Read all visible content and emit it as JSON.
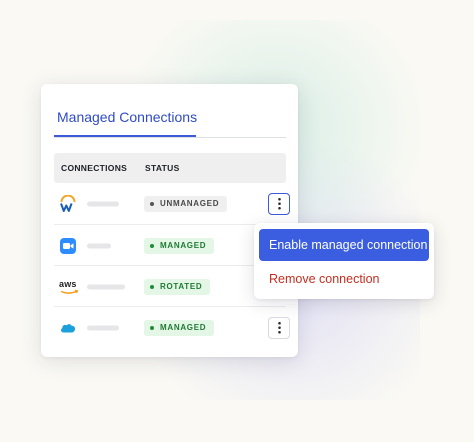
{
  "card": {
    "tab_label": "Managed Connections",
    "columns": {
      "connections": "CONNECTIONS",
      "status": "STATUS"
    },
    "rows": [
      {
        "logo": "workday-logo-icon",
        "status": "UNMANAGED",
        "has_menu_button": true,
        "menu_open": true
      },
      {
        "logo": "zoom-logo-icon",
        "status": "MANAGED",
        "has_menu_button": false
      },
      {
        "logo": "aws-logo-icon",
        "logo_text": "aws",
        "status": "ROTATED",
        "has_menu_button": false
      },
      {
        "logo": "salesforce-logo-icon",
        "logo_text": "salesforce",
        "status": "MANAGED",
        "has_menu_button": true,
        "menu_open": false
      }
    ]
  },
  "menu": {
    "enable_label": "Enable managed connection",
    "remove_label": "Remove connection"
  },
  "colors": {
    "accent": "#3d5bd9",
    "managed_green": "#1e7b33",
    "danger": "#c62d1f"
  }
}
